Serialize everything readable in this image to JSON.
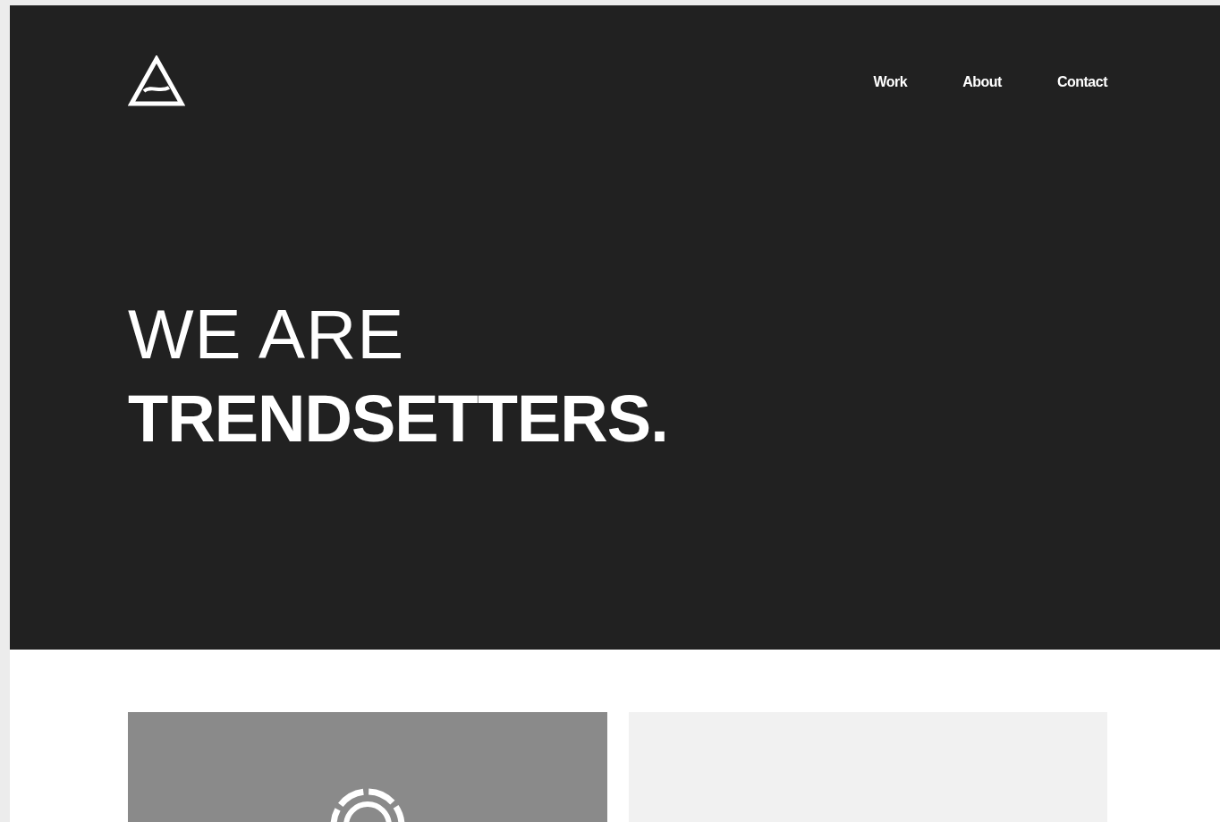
{
  "nav": {
    "items": [
      {
        "label": "Work"
      },
      {
        "label": "About"
      },
      {
        "label": "Contact"
      }
    ]
  },
  "hero": {
    "line_1": "WE ARE",
    "line_2": "TRENDSETTERS."
  }
}
